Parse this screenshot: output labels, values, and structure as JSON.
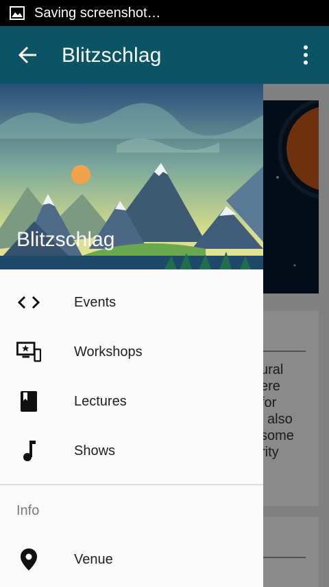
{
  "status_bar": {
    "notification_text": "Saving screenshot…",
    "icon": "image-icon"
  },
  "app_bar": {
    "title": "Blitzschlag",
    "back_icon": "arrow-back-icon",
    "overflow_icon": "more-vert-icon"
  },
  "background_content": {
    "text_lines": [
      "ural",
      "ere",
      "for",
      "l also",
      "some",
      "rity"
    ]
  },
  "drawer": {
    "header_title": "Blitzschlag",
    "items": [
      {
        "label": "Events",
        "icon": "code-icon"
      },
      {
        "label": "Workshops",
        "icon": "devices-star-icon"
      },
      {
        "label": "Lectures",
        "icon": "book-icon"
      },
      {
        "label": "Shows",
        "icon": "music-note-icon"
      }
    ],
    "section_label": "Info",
    "info_items": [
      {
        "label": "Venue",
        "icon": "location-pin-icon"
      }
    ]
  }
}
